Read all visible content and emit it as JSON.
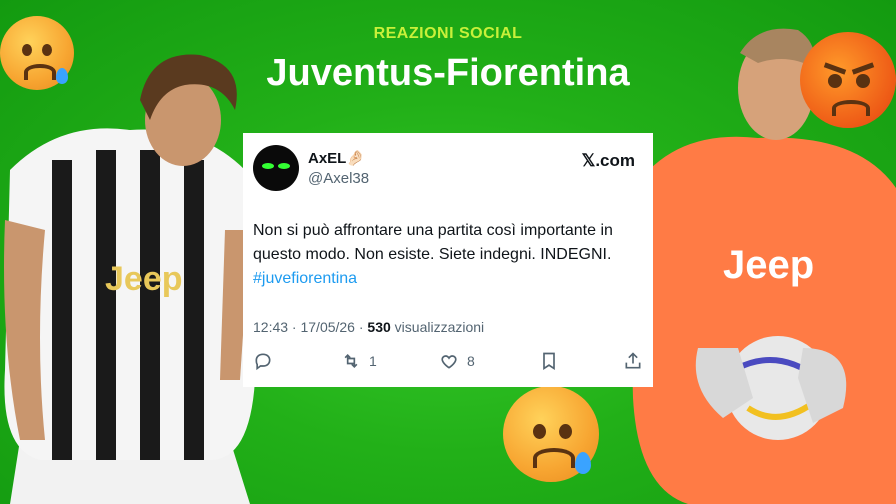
{
  "header": {
    "kicker": "REAZIONI SOCIAL",
    "title": "Juventus-Fiorentina"
  },
  "tweet": {
    "name": "AxEL",
    "name_emoji": "🤌🏻",
    "handle": "@Axel38",
    "source": "𝕏.com",
    "text_main": "Non si può affrontare una partita così importante in questo modo. Non esiste. Siete indegni. INDEGNI. ",
    "hashtag": "#juvefiorentina",
    "time": "12:43 · 17/05/26 · ",
    "views_count": "530",
    "views_label": " visualizzazioni",
    "retweets": "1",
    "likes": "8"
  },
  "colors": {
    "background": "#22b018",
    "kicker": "#c8f03a",
    "hashtag": "#1d9bf0"
  },
  "icons": [
    "reply-icon",
    "retweet-icon",
    "like-icon",
    "bookmark-icon",
    "share-icon"
  ]
}
